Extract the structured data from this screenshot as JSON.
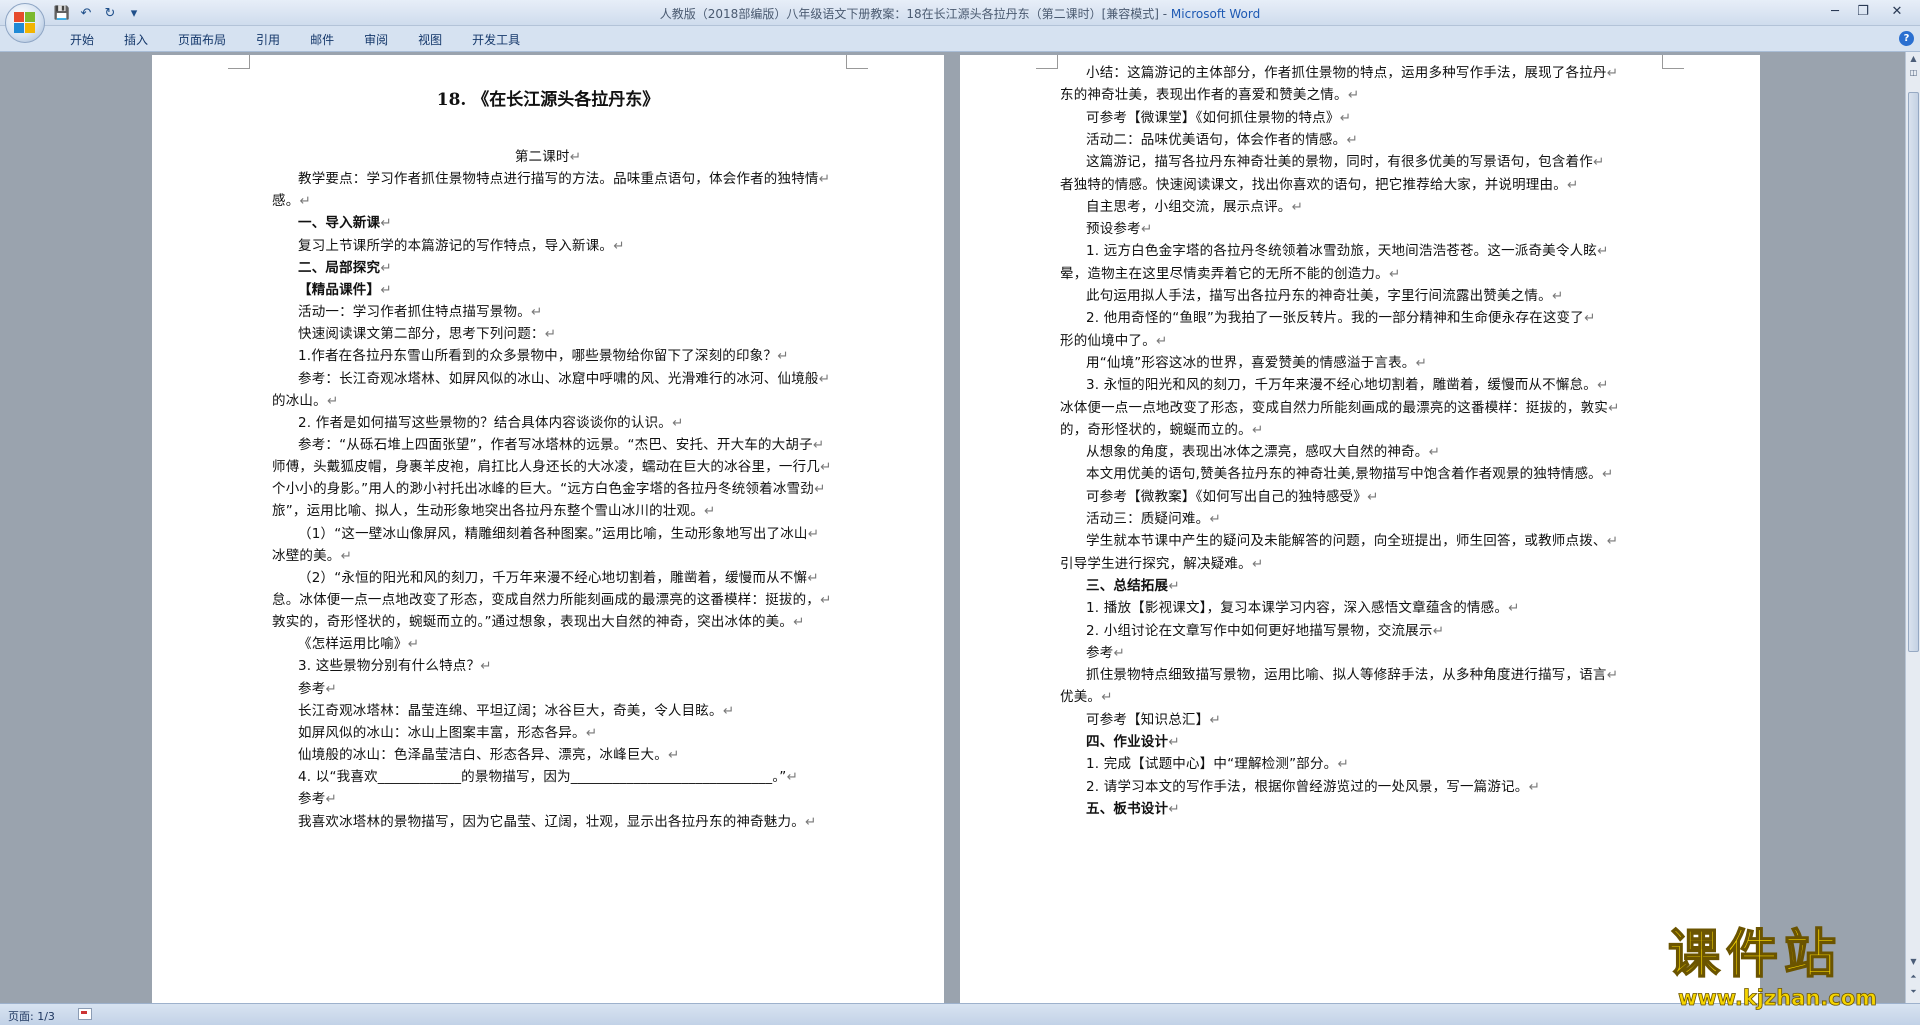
{
  "window": {
    "title": "人教版（2018部编版）八年级语文下册教案：18在长江源头各拉丹东（第二课时）[兼容模式] - ",
    "app_name": "Microsoft Word"
  },
  "quick_access": [
    "save-icon",
    "undo-icon",
    "redo-icon",
    "customize-icon"
  ],
  "ribbon": {
    "tabs": [
      "开始",
      "插入",
      "页面布局",
      "引用",
      "邮件",
      "审阅",
      "视图",
      "开发工具"
    ]
  },
  "document": {
    "title": "18. 《在长江源头各拉丹东》",
    "left_page": [
      {
        "text": "第二课时",
        "bold": false,
        "center": true
      },
      {
        "text": "教学要点：学习作者抓住景物特点进行描写的方法。品味重点语句，体会作者的独特情",
        "bold": false,
        "indent": true
      },
      {
        "text": "感。",
        "bold": false
      },
      {
        "text": "一、导入新课",
        "bold": true,
        "indent": true
      },
      {
        "text": "复习上节课所学的本篇游记的写作特点，导入新课。",
        "bold": false,
        "indent": true
      },
      {
        "text": "二、局部探究",
        "bold": true,
        "indent": true
      },
      {
        "text": "【精品课件】",
        "bold": true,
        "indent": true
      },
      {
        "text": "活动一：学习作者抓住特点描写景物。",
        "bold": false,
        "indent": true
      },
      {
        "text": "快速阅读课文第二部分，思考下列问题：",
        "bold": false,
        "indent": true
      },
      {
        "text": "1.作者在各拉丹东雪山所看到的众多景物中，哪些景物给你留下了深刻的印象？",
        "bold": false,
        "indent": true
      },
      {
        "text": "参考：长江奇观冰塔林、如屏风似的冰山、冰窟中呼啸的风、光滑难行的冰河、仙境般",
        "bold": false,
        "indent": true
      },
      {
        "text": "的冰山。",
        "bold": false
      },
      {
        "text": "2. 作者是如何描写这些景物的？结合具体内容谈谈你的认识。",
        "bold": false,
        "indent": true
      },
      {
        "text": "参考：“从砾石堆上四面张望”，作者写冰塔林的远景。“杰巴、安托、开大车的大胡子",
        "bold": false,
        "indent": true
      },
      {
        "text": "师傅，头戴狐皮帽，身裹羊皮袍，肩扛比人身还长的大冰凌，蠕动在巨大的冰谷里，一行几",
        "bold": false
      },
      {
        "text": "个小小的身影。”用人的渺小衬托出冰峰的巨大。“远方白色金字塔的各拉丹冬统领着冰雪劲",
        "bold": false
      },
      {
        "text": "旅”，运用比喻、拟人，生动形象地突出各拉丹东整个雪山冰川的壮观。",
        "bold": false
      },
      {
        "text": "（1）“这一壁冰山像屏风，精雕细刻着各种图案。”运用比喻，生动形象地写出了冰山",
        "bold": false,
        "indent": true
      },
      {
        "text": "冰壁的美。",
        "bold": false
      },
      {
        "text": "（2）“永恒的阳光和风的刻刀，千万年来漫不经心地切割着，雕凿着，缓慢而从不懈",
        "bold": false,
        "indent": true
      },
      {
        "text": "怠。冰体便一点一点地改变了形态，变成自然力所能刻画成的最漂亮的这番模样：挺拔的，",
        "bold": false
      },
      {
        "text": "敦实的，奇形怪状的，蜿蜒而立的。”通过想象，表现出大自然的神奇，突出冰体的美。",
        "bold": false
      },
      {
        "text": "《怎样运用比喻》",
        "bold": false,
        "indent": true
      },
      {
        "text": "3. 这些景物分别有什么特点？",
        "bold": false,
        "indent": true
      },
      {
        "text": "参考",
        "bold": false,
        "indent": true
      },
      {
        "text": "长江奇观冰塔林：晶莹连绵、平坦辽阔；冰谷巨大，奇美，令人目眩。",
        "bold": false,
        "indent": true
      },
      {
        "text": "如屏风似的冰山：冰山上图案丰富，形态各异。",
        "bold": false,
        "indent": true
      },
      {
        "text": "仙境般的冰山：色泽晶莹洁白、形态各异、漂亮，冰峰巨大。",
        "bold": false,
        "indent": true
      },
      {
        "text": "4. 以“我喜欢____________的景物描写，因为_____________________________。”",
        "bold": false,
        "indent": true
      },
      {
        "text": "参考",
        "bold": false,
        "indent": true
      },
      {
        "text": "我喜欢冰塔林的景物描写，因为它晶莹、辽阔，壮观，显示出各拉丹东的神奇魅力。",
        "bold": false,
        "indent": true
      }
    ],
    "right_page": [
      {
        "text": "小结：这篇游记的主体部分，作者抓住景物的特点，运用多种写作手法，展现了各拉丹",
        "bold": false,
        "indent": true
      },
      {
        "text": "东的神奇壮美，表现出作者的喜爱和赞美之情。",
        "bold": false
      },
      {
        "text": "可参考【微课堂】《如何抓住景物的特点》",
        "bold": false,
        "indent": true
      },
      {
        "text": "活动二：品味优美语句，体会作者的情感。",
        "bold": false,
        "indent": true
      },
      {
        "text": "这篇游记，描写各拉丹东神奇壮美的景物，同时，有很多优美的写景语句，包含着作",
        "bold": false,
        "indent": true
      },
      {
        "text": "者独特的情感。快速阅读课文，找出你喜欢的语句，把它推荐给大家，并说明理由。",
        "bold": false
      },
      {
        "text": "自主思考，小组交流，展示点评。",
        "bold": false,
        "indent": true
      },
      {
        "text": "预设参考",
        "bold": false,
        "indent": true
      },
      {
        "text": "1. 远方白色金字塔的各拉丹冬统领着冰雪劲旅，天地间浩浩苍苍。这一派奇美令人眩",
        "bold": false,
        "indent": true
      },
      {
        "text": "晕，造物主在这里尽情卖弄着它的无所不能的创造力。",
        "bold": false
      },
      {
        "text": "此句运用拟人手法，描写出各拉丹东的神奇壮美，字里行间流露出赞美之情。",
        "bold": false,
        "indent": true
      },
      {
        "text": "2. 他用奇怪的“鱼眼”为我拍了一张反转片。我的一部分精神和生命便永存在这变了",
        "bold": false,
        "indent": true
      },
      {
        "text": "形的仙境中了。",
        "bold": false
      },
      {
        "text": "用“仙境”形容这冰的世界，喜爱赞美的情感溢于言表。",
        "bold": false,
        "indent": true
      },
      {
        "text": "3. 永恒的阳光和风的刻刀，千万年来漫不经心地切割着，雕凿着，缓慢而从不懈怠。",
        "bold": false,
        "indent": true
      },
      {
        "text": "冰体便一点一点地改变了形态，变成自然力所能刻画成的最漂亮的这番模样：挺拔的，敦实",
        "bold": false
      },
      {
        "text": "的，奇形怪状的，蜿蜒而立的。",
        "bold": false
      },
      {
        "text": "从想象的角度，表现出冰体之漂亮，感叹大自然的神奇。",
        "bold": false,
        "indent": true
      },
      {
        "text": "本文用优美的语句,赞美各拉丹东的神奇壮美,景物描写中饱含着作者观景的独特情感。",
        "bold": false,
        "indent": true
      },
      {
        "text": "可参考【微教案】《如何写出自己的独特感受》",
        "bold": false,
        "indent": true
      },
      {
        "text": "活动三：质疑问难。",
        "bold": false,
        "indent": true
      },
      {
        "text": "学生就本节课中产生的疑问及未能解答的问题，向全班提出，师生回答，或教师点拨、",
        "bold": false,
        "indent": true
      },
      {
        "text": "引导学生进行探究，解决疑难。",
        "bold": false
      },
      {
        "text": "三、总结拓展",
        "bold": true,
        "indent": true
      },
      {
        "text": "1. 播放【影视课文】，复习本课学习内容，深入感悟文章蕴含的情感。",
        "bold": false,
        "indent": true
      },
      {
        "text": "2. 小组讨论在文章写作中如何更好地描写景物，交流展示",
        "bold": false,
        "indent": true
      },
      {
        "text": "参考",
        "bold": false,
        "indent": true
      },
      {
        "text": "抓住景物特点细致描写景物，运用比喻、拟人等修辞手法，从多种角度进行描写，语言",
        "bold": false,
        "indent": true
      },
      {
        "text": "优美。",
        "bold": false
      },
      {
        "text": "可参考【知识总汇】",
        "bold": false,
        "indent": true
      },
      {
        "text": "四、作业设计",
        "bold": true,
        "indent": true
      },
      {
        "text": "1. 完成【试题中心】中“理解检测”部分。",
        "bold": false,
        "indent": true
      },
      {
        "text": "2. 请学习本文的写作手法，根据你曾经游览过的一处风景，写一篇游记。",
        "bold": false,
        "indent": true
      },
      {
        "text": "五、板书设计",
        "bold": true,
        "indent": true
      }
    ]
  },
  "status": {
    "page": "页面: 1/3"
  },
  "watermark": {
    "text": "课件站",
    "url": "www.kjzhan.com"
  }
}
